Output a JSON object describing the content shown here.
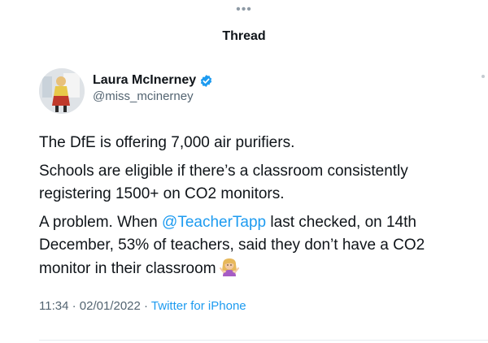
{
  "nav": {
    "grabber": "•••",
    "title": "Thread"
  },
  "tweet": {
    "author": {
      "display_name": "Laura McInerney",
      "handle": "@miss_mcinerney",
      "verified": true
    },
    "paragraphs": {
      "p1": "The DfE is offering 7,000 air purifiers.",
      "p2": "Schools are eligible if there’s a classroom consistently registering 1500+ on CO2 monitors.",
      "p3_before": "A problem. When ",
      "p3_mention": "@TeacherTapp",
      "p3_after": " last checked, on 14th December, 53% of teachers, said they don’t have a CO2 monitor in their classroom"
    },
    "emoji": "woman-shrugging",
    "meta": {
      "time": "11:34",
      "separator1": " · ",
      "date": "02/01/2022",
      "separator2": " · ",
      "source": "Twitter for iPhone"
    }
  },
  "colors": {
    "link": "#1d9bf0",
    "secondary_text": "#536471",
    "primary_text": "#0f1419"
  }
}
